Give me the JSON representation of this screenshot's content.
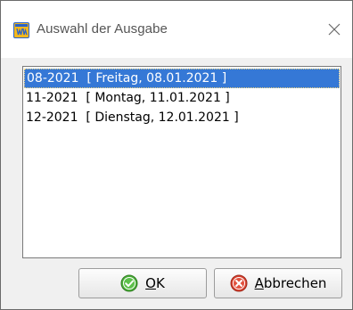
{
  "window": {
    "title": "Auswahl der Ausgabe",
    "app_icon": "calendar-app-icon",
    "close_glyph": "×"
  },
  "list": {
    "items": [
      {
        "issue": "08-2021",
        "date": "[ Freitag, 08.01.2021 ]",
        "selected": true
      },
      {
        "issue": "11-2021",
        "date": "[ Montag, 11.01.2021 ]",
        "selected": false
      },
      {
        "issue": "12-2021",
        "date": "[ Dienstag, 12.01.2021 ]",
        "selected": false
      }
    ]
  },
  "buttons": {
    "ok": {
      "mnemonic": "O",
      "rest": "K",
      "icon": "green-check-icon"
    },
    "cancel": {
      "mnemonic": "A",
      "rest": "bbrechen",
      "icon": "red-x-icon"
    }
  },
  "colors": {
    "selection": "#3578d6",
    "ok_icon": "#4caf3a",
    "cancel_icon": "#d9412f"
  }
}
